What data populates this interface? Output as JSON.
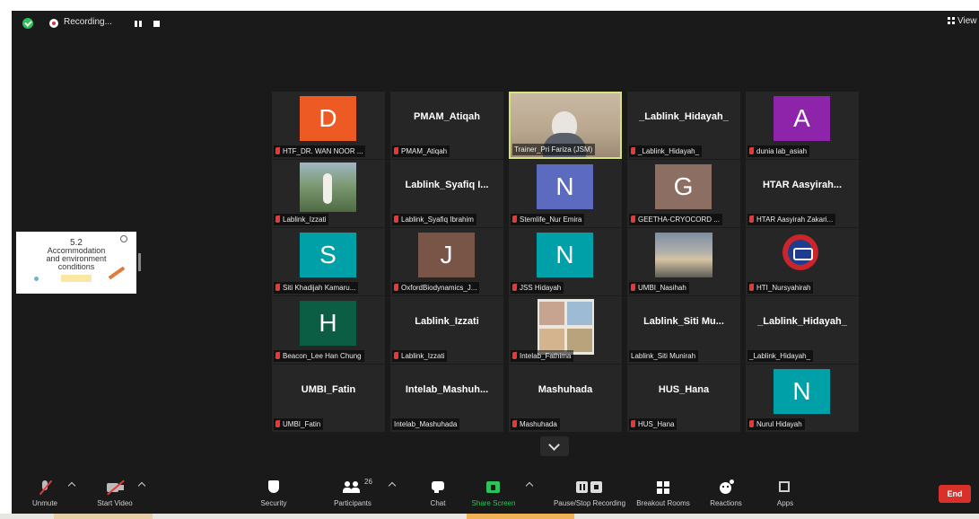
{
  "recording": {
    "label": "Recording..."
  },
  "view_button": {
    "label": "View"
  },
  "shared_slide": {
    "number": "5.2",
    "lines": [
      "Accommodation",
      "and environment",
      "conditions"
    ]
  },
  "tiles": [
    {
      "kind": "avatar",
      "letter": "D",
      "color": "#ee5a24",
      "label": "HTF_DR. WAN NOOR ..."
    },
    {
      "kind": "name",
      "title": "PMAM_Atiqah",
      "label": "PMAM_Atiqah"
    },
    {
      "kind": "video",
      "label": "Trainer_Pri Fariza (JSM)",
      "active": true,
      "muted": false
    },
    {
      "kind": "name",
      "title": "_Lablink_Hidayah_",
      "label": "_Lablink_Hidayah_"
    },
    {
      "kind": "avatar",
      "letter": "A",
      "color": "#8e24aa",
      "label": "dunia lab_asiah"
    },
    {
      "kind": "photo",
      "label": "Lablink_Izzati"
    },
    {
      "kind": "name",
      "title": "Lablink_Syafiq I...",
      "label": "Lablink_Syafiq Ibrahim"
    },
    {
      "kind": "avatar",
      "letter": "N",
      "color": "#5c6bc0",
      "label": "Stemlife_Nur Emira"
    },
    {
      "kind": "avatar",
      "letter": "G",
      "color": "#8d6e63",
      "label": "GEETHA-CRYOCORD ..."
    },
    {
      "kind": "name",
      "title": "HTAR Aasyirah...",
      "label": "HTAR Aasyirah Zakari..."
    },
    {
      "kind": "avatar",
      "letter": "S",
      "color": "#00a0a8",
      "label": "Siti Khadijah Kamaru..."
    },
    {
      "kind": "avatar",
      "letter": "J",
      "color": "#795548",
      "label": "OxfordBiodynamics_J..."
    },
    {
      "kind": "avatar",
      "letter": "N",
      "color": "#00a0a8",
      "label": "JSS Hidayah"
    },
    {
      "kind": "photo2",
      "label": "UMBI_Nasihah"
    },
    {
      "kind": "logo",
      "label": "HTI_Nursyahirah"
    },
    {
      "kind": "avatar",
      "letter": "H",
      "color": "#0b5e44",
      "label": "Beacon_Lee Han Chung"
    },
    {
      "kind": "name",
      "title": "Lablink_Izzati",
      "label": "Lablink_Izzati"
    },
    {
      "kind": "photo3",
      "label": "Intelab_Fathima"
    },
    {
      "kind": "name",
      "title": "Lablink_Siti  Mu...",
      "label": "Lablink_Siti Munirah",
      "muted": false
    },
    {
      "kind": "name",
      "title": "_Lablink_Hidayah_",
      "label": "_Lablink_Hidayah_",
      "muted": false
    },
    {
      "kind": "name",
      "title": "UMBI_Fatin",
      "label": "UMBI_Fatin"
    },
    {
      "kind": "name",
      "title": "Intelab_Mashuh...",
      "label": "Intelab_Mashuhada",
      "muted": false
    },
    {
      "kind": "name",
      "title": "Mashuhada",
      "label": "Mashuhada"
    },
    {
      "kind": "name",
      "title": "HUS_Hana",
      "label": "HUS_Hana"
    },
    {
      "kind": "avatar",
      "letter": "N",
      "color": "#00a0a8",
      "label": "Nurul Hidayah"
    }
  ],
  "toolbar": {
    "unmute": "Unmute",
    "start_video": "Start Video",
    "security": "Security",
    "participants": "Participants",
    "participants_count": "26",
    "chat": "Chat",
    "share_screen": "Share Screen",
    "pause_recording": "Pause/Stop Recording",
    "breakout_rooms": "Breakout Rooms",
    "reactions": "Reactions",
    "apps": "Apps",
    "end": "End"
  }
}
